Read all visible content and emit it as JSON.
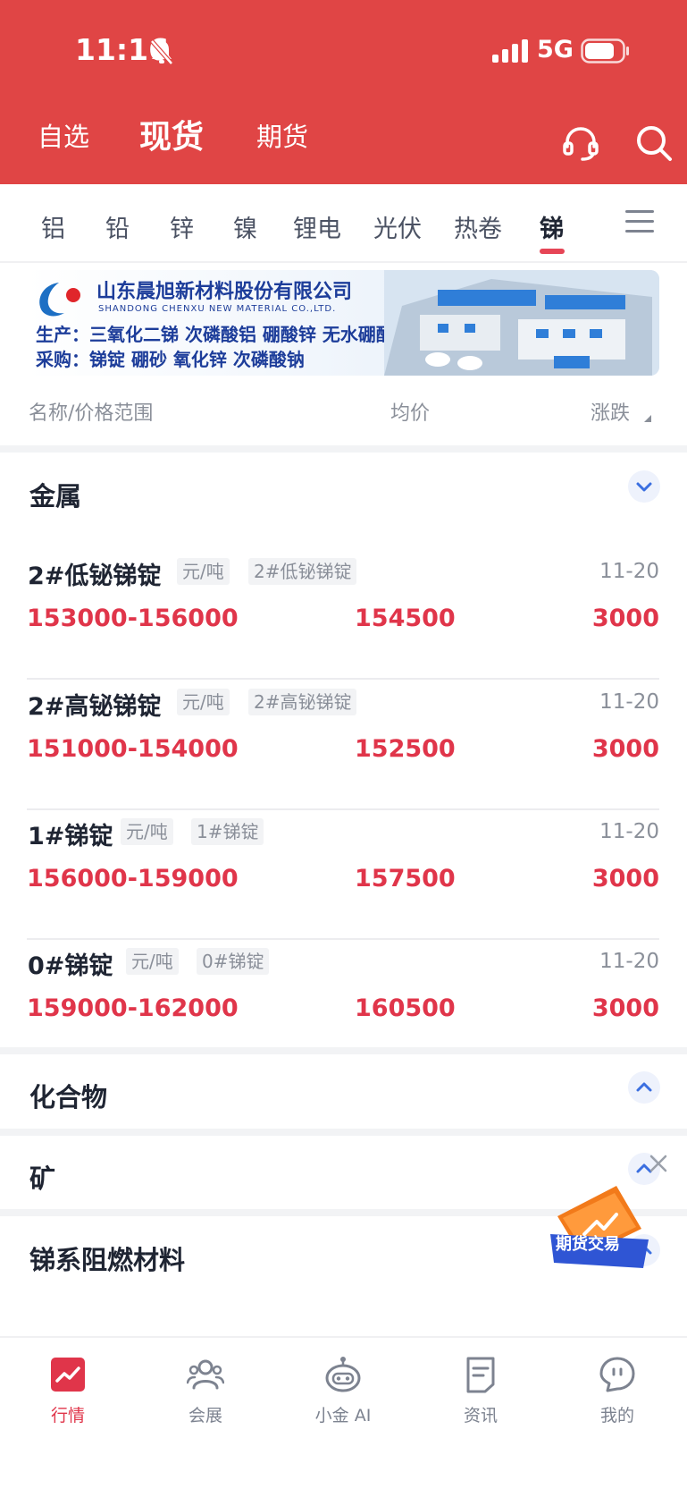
{
  "status_bar": {
    "time": "11:16",
    "network": "5G"
  },
  "header": {
    "tabs": [
      {
        "label": "自选",
        "active": false
      },
      {
        "label": "现货",
        "active": true
      },
      {
        "label": "期货",
        "active": false
      }
    ],
    "icons": [
      "headset-icon",
      "search-icon"
    ],
    "background_color": "#e04545"
  },
  "categories": {
    "items": [
      "铝",
      "铅",
      "锌",
      "镍",
      "锂电",
      "光伏",
      "热卷",
      "锑"
    ],
    "active": "锑",
    "accent_color": "#e64556"
  },
  "banner": {
    "company_cn": "山东晨旭新材料股份有限公司",
    "company_en": "SHANDONG CHENXU NEW MATERIAL CO.,LTD.",
    "line1": "生产：三氧化二锑  次磷酸铝  硼酸锌  无水硼酸锌",
    "line2": "采购：锑锭 硼砂 氧化锌 次磷酸钠"
  },
  "columns": {
    "name": "名称/价格范围",
    "avg": "均价",
    "change": "涨跌"
  },
  "sections": {
    "metal": {
      "title": "金属",
      "expanded": true,
      "items": [
        {
          "name": "2#低铋锑锭",
          "unit": "元/吨",
          "tag": "2#低铋锑锭",
          "date": "11-20",
          "range": "153000-156000",
          "avg": "154500",
          "change": "3000"
        },
        {
          "name": "2#高铋锑锭",
          "unit": "元/吨",
          "tag": "2#高铋锑锭",
          "date": "11-20",
          "range": "151000-154000",
          "avg": "152500",
          "change": "3000"
        },
        {
          "name": "1#锑锭",
          "unit": "元/吨",
          "tag": "1#锑锭",
          "date": "11-20",
          "range": "156000-159000",
          "avg": "157500",
          "change": "3000"
        },
        {
          "name": "0#锑锭",
          "unit": "元/吨",
          "tag": "0#锑锭",
          "date": "11-20",
          "range": "159000-162000",
          "avg": "160500",
          "change": "3000"
        }
      ]
    },
    "compound": {
      "title": "化合物",
      "expanded": false
    },
    "ore": {
      "title": "矿",
      "expanded": false
    },
    "flame": {
      "title": "锑系阻燃材料",
      "expanded": false
    }
  },
  "promo": {
    "label": "期货交易"
  },
  "bottom_nav": [
    {
      "label": "行情",
      "icon": "chart-trend-icon",
      "active": true
    },
    {
      "label": "会展",
      "icon": "people-icon",
      "active": false
    },
    {
      "label": "小金 AI",
      "icon": "robot-icon",
      "active": false
    },
    {
      "label": "资讯",
      "icon": "document-icon",
      "active": false
    },
    {
      "label": "我的",
      "icon": "profile-face-icon",
      "active": false
    }
  ],
  "colors": {
    "price_red": "#e0354a",
    "text_dark": "#1f2533",
    "muted": "#8a8f99"
  }
}
